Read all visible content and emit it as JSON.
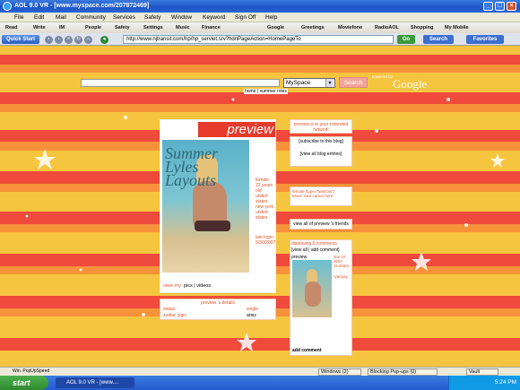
{
  "window": {
    "title": "AOL 9.0 VR - [www.myspace.com/207872469]"
  },
  "menu": [
    "File",
    "Edit",
    "Mail",
    "Community",
    "Services",
    "Safety",
    "Window",
    "Keyword",
    "Sign Off",
    "Help"
  ],
  "toolbar": {
    "items": [
      "Read",
      "Write",
      "IM",
      "People",
      "Safety",
      "Settings",
      "Music",
      "Finance"
    ],
    "search_items": [
      "Google",
      "Greetings",
      "Moviefone",
      "RadioAOL",
      "Shopping",
      "My Mobile"
    ]
  },
  "address_bar": {
    "quick_start": "Quick Start",
    "url": "http://www.njtransit.com/hp/hp_servlet.srv?hdnPageAction=HomePageTo",
    "go_label": "Go",
    "search_label": "Search",
    "favorites_label": "Favorites"
  },
  "page": {
    "search_dropdown": "MySpace",
    "search_button": "Search",
    "powered_by": "powered by",
    "google": "Google",
    "nav_links": "home | summer roles",
    "profile": {
      "name_banner": "preview",
      "profile_image_text": "Summer Lyles Layouts",
      "details": [
        "female",
        "22 years",
        "old",
        "united",
        "states",
        "new york",
        "united",
        "states"
      ],
      "last_login": "last login: 6/30/2007",
      "view_my": "view my:",
      "pics": "pics",
      "videos": "videos"
    },
    "extended_network": "preview is in your extended network",
    "subscribe": "[subscribe to this blog]",
    "view_entries": "[view all blog entries]",
    "embed_code": "female (type=\"text/css\")",
    "embed_code2": "Move Your cursor here",
    "friends": "view all of preview 's friends",
    "comments_header": "displaying 6 comments",
    "view_all_comments": "view all",
    "add_comment_top": "add comment",
    "commenter": "preview",
    "comment_date": "Jun 10 2007 11:20am",
    "comment_text": "ryanyay",
    "add_comment_bottom": "add comment",
    "details_title": "preview 's details",
    "status_label": "status:",
    "status_value": "single",
    "zodiac_label": "zodiac sign:",
    "zodiac_value": "aries"
  },
  "statusbar": {
    "windows": "Windows (2)",
    "popup": "Blocking Pop-ups (0)",
    "vault": "Vault"
  },
  "taskbar": {
    "start": "start",
    "tasks": [
      "AOL 9.0 VR - [www....",
      "Win. PopUpSpeed"
    ],
    "clock": "5:24 PM"
  },
  "colors": {
    "stripe_red": "#ef4a3c",
    "stripe_orange": "#f7923a",
    "stripe_yellow": "#f6c53f",
    "link_red": "#e0542c"
  }
}
